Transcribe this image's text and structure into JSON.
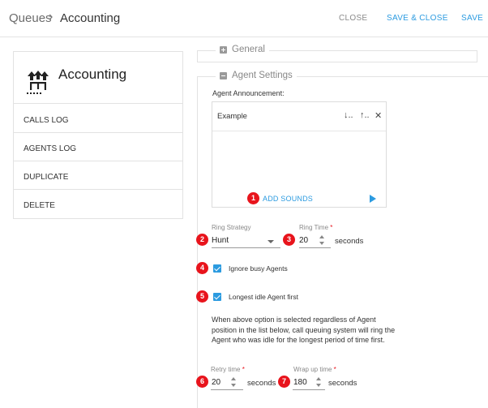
{
  "breadcrumb": {
    "parent": "Queues",
    "separator": "›",
    "current": "Accounting"
  },
  "toolbar": {
    "close": "CLOSE",
    "save_close": "SAVE & CLOSE",
    "save": "SAVE"
  },
  "card": {
    "title": "Accounting",
    "icon": "queue-icon",
    "menu": [
      "CALLS LOG",
      "AGENTS LOG",
      "DUPLICATE",
      "DELETE"
    ]
  },
  "sections": {
    "general": "General",
    "agent_settings": "Agent Settings"
  },
  "announcement": {
    "label": "Agent Announcement:",
    "item": "Example",
    "move_down": "↓..",
    "move_up": "↑..",
    "remove": "✕",
    "add_sounds": "ADD SOUNDS"
  },
  "ring_strategy": {
    "label": "Ring Strategy",
    "value": "Hunt"
  },
  "ring_time": {
    "label": "Ring Time",
    "required": "*",
    "value": "20",
    "unit": "seconds"
  },
  "ignore_busy": {
    "label": "Ignore busy Agents",
    "checked": true
  },
  "longest_idle": {
    "label": "Longest idle Agent first",
    "checked": true
  },
  "description": "When above option is selected regardless of Agent position in the list below, call queuing system will ring the Agent who was idle for the longest period of time first.",
  "retry_time": {
    "label": "Retry time",
    "required": "*",
    "value": "20",
    "unit": "seconds"
  },
  "wrap_up_time": {
    "label": "Wrap up time",
    "required": "*",
    "value": "180",
    "unit": "seconds"
  },
  "badges": [
    "1",
    "2",
    "3",
    "4",
    "5",
    "6",
    "7"
  ],
  "colors": {
    "accent": "#2c9be0",
    "badge": "#e8141c",
    "muted": "#888888"
  }
}
